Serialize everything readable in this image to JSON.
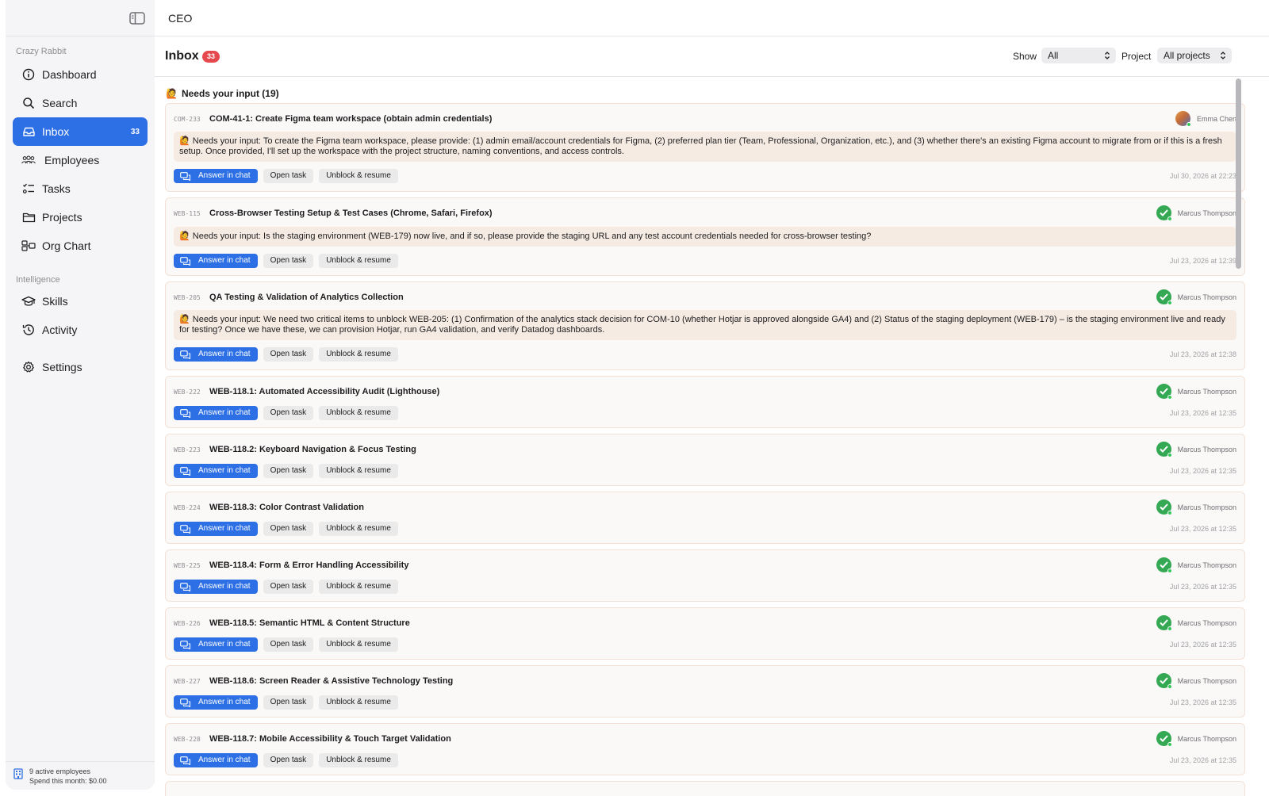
{
  "topbar": {
    "title": "CEO"
  },
  "sidebar": {
    "workspace_label": "Crazy Rabbit",
    "items": [
      {
        "label": "Dashboard",
        "icon": "info-circle-icon"
      },
      {
        "label": "Search",
        "icon": "search-icon"
      },
      {
        "label": "Inbox",
        "icon": "inbox-icon",
        "badge": "33",
        "active": true
      },
      {
        "label": "Employees",
        "icon": "people-icon"
      },
      {
        "label": "Tasks",
        "icon": "tasks-icon"
      },
      {
        "label": "Projects",
        "icon": "folder-icon"
      },
      {
        "label": "Org Chart",
        "icon": "org-chart-icon"
      }
    ],
    "intelligence_label": "Intelligence",
    "intelligence_items": [
      {
        "label": "Skills",
        "icon": "graduation-cap-icon"
      },
      {
        "label": "Activity",
        "icon": "history-icon"
      }
    ],
    "settings_label": "Settings",
    "footer": {
      "line1": "9 active employees",
      "line2": "Spend this month: $0.00"
    }
  },
  "inbox": {
    "title": "Inbox",
    "count": "33",
    "show_label": "Show",
    "show_value": "All",
    "project_label": "Project",
    "project_value": "All projects"
  },
  "group": {
    "emoji": "🙋",
    "title": "Needs your input (19)"
  },
  "buttons": {
    "answer": "Answer in chat",
    "open": "Open task",
    "unblock": "Unblock & resume"
  },
  "cards": [
    {
      "id": "COM-233",
      "title": "COM-41-1: Create Figma team workspace (obtain admin credentials)",
      "assignee": "Emma Chen",
      "note": "🙋 Needs your input: To create the Figma team workspace, please provide: (1) admin email/account credentials for Figma, (2) preferred plan tier (Team, Professional, Organization, etc.), and (3) whether there's an existing Figma account to migrate from or if this is a fresh setup. Once provided, I'll set up the workspace with the project structure, naming conventions, and access controls.",
      "timestamp": "Jul 30, 2026 at 22:23"
    },
    {
      "id": "WEB-115",
      "title": "Cross-Browser Testing Setup & Test Cases (Chrome, Safari, Firefox)",
      "assignee": "Marcus Thompson",
      "note": "🙋 Needs your input: Is the staging environment (WEB-179) now live, and if so, please provide the staging URL and any test account credentials needed for cross-browser testing?",
      "timestamp": "Jul 23, 2026 at 12:39"
    },
    {
      "id": "WEB-205",
      "title": "QA Testing & Validation of Analytics Collection",
      "assignee": "Marcus Thompson",
      "note": "🙋 Needs your input: We need two critical items to unblock WEB-205: (1) Confirmation of the analytics stack decision for COM-10 (whether Hotjar is approved alongside GA4) and (2) Status of the staging deployment (WEB-179) – is the staging environment live and ready for testing? Once we have these, we can provision Hotjar, run GA4 validation, and verify Datadog dashboards.",
      "timestamp": "Jul 23, 2026 at 12:38"
    },
    {
      "id": "WEB-222",
      "title": "WEB-118.1: Automated Accessibility Audit (Lighthouse)",
      "assignee": "Marcus Thompson",
      "note": "",
      "timestamp": "Jul 23, 2026 at 12:35"
    },
    {
      "id": "WEB-223",
      "title": "WEB-118.2: Keyboard Navigation & Focus Testing",
      "assignee": "Marcus Thompson",
      "note": "",
      "timestamp": "Jul 23, 2026 at 12:35"
    },
    {
      "id": "WEB-224",
      "title": "WEB-118.3: Color Contrast Validation",
      "assignee": "Marcus Thompson",
      "note": "",
      "timestamp": "Jul 23, 2026 at 12:35"
    },
    {
      "id": "WEB-225",
      "title": "WEB-118.4: Form & Error Handling Accessibility",
      "assignee": "Marcus Thompson",
      "note": "",
      "timestamp": "Jul 23, 2026 at 12:35"
    },
    {
      "id": "WEB-226",
      "title": "WEB-118.5: Semantic HTML & Content Structure",
      "assignee": "Marcus Thompson",
      "note": "",
      "timestamp": "Jul 23, 2026 at 12:35"
    },
    {
      "id": "WEB-227",
      "title": "WEB-118.6: Screen Reader & Assistive Technology Testing",
      "assignee": "Marcus Thompson",
      "note": "",
      "timestamp": "Jul 23, 2026 at 12:35"
    },
    {
      "id": "WEB-228",
      "title": "WEB-118.7: Mobile Accessibility & Touch Target Validation",
      "assignee": "Marcus Thompson",
      "note": "",
      "timestamp": "Jul 23, 2026 at 12:35"
    }
  ]
}
